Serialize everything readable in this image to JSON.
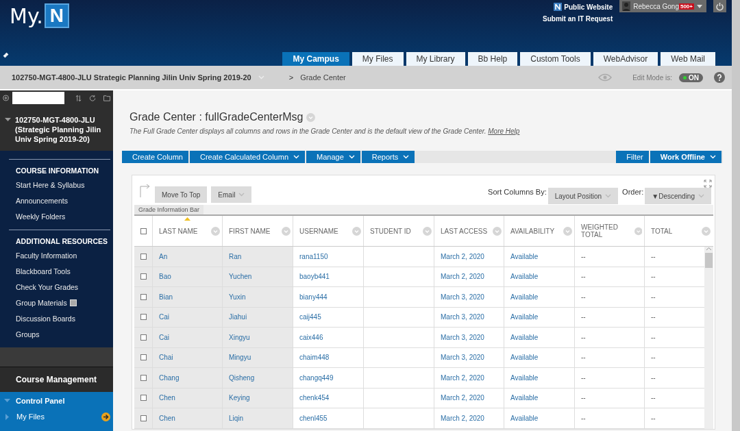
{
  "header": {
    "logo": {
      "text": "My.",
      "mark": "N"
    },
    "links": [
      "Public Website",
      "Submit an IT Request"
    ],
    "user": {
      "name": "Rebecca Gong",
      "badge": "500+"
    },
    "tabs": [
      {
        "label": "My Campus",
        "selected": true
      },
      {
        "label": "My Files",
        "selected": false
      },
      {
        "label": "My Library",
        "selected": false
      },
      {
        "label": "Bb Help",
        "selected": false
      },
      {
        "label": "Custom Tools",
        "selected": false
      },
      {
        "label": "WebAdvisor",
        "selected": false
      },
      {
        "label": "Web Mail",
        "selected": false
      }
    ]
  },
  "breadcrumb": {
    "course": "102750-MGT-4800-JLU Strategic Planning Jilin Univ Spring 2019-20",
    "separator": ">",
    "current": "Grade Center",
    "edit_mode": {
      "label": "Edit Mode is:",
      "value": "ON",
      "on": true
    }
  },
  "sidebar": {
    "course": {
      "title": "102750-MGT-4800-JLU (Strategic Planning Jilin Univ Spring 2019-20)",
      "expanded": true
    },
    "sections": [
      {
        "heading": "COURSE INFORMATION",
        "items": [
          {
            "label": "Start Here & Syllabus",
            "kind": "link"
          },
          {
            "label": "Announcements",
            "kind": "link"
          },
          {
            "label": "Weekly Folders",
            "kind": "link"
          }
        ]
      },
      {
        "heading": "ADDITIONAL RESOURCES",
        "items": [
          {
            "label": "Faculty Information",
            "kind": "link"
          },
          {
            "label": "Blackboard Tools",
            "kind": "link"
          },
          {
            "label": "Check Your Grades",
            "kind": "link"
          },
          {
            "label": "Group Materials",
            "kind": "link-with-icon"
          },
          {
            "label": "Discussion Boards",
            "kind": "link"
          },
          {
            "label": "Groups",
            "kind": "link"
          }
        ]
      }
    ],
    "management": "Course Management",
    "control_panel": {
      "label": "Control Panel",
      "expanded": true,
      "items": [
        {
          "label": "My Files",
          "expanded": false
        }
      ]
    }
  },
  "main": {
    "title": "Grade Center : fullGradeCenterMsg",
    "description": "The Full Grade Center displays all columns and rows in the Grade Center and is the default view of the Grade Center.",
    "help_link": "More Help",
    "toolbar_left": [
      {
        "label": "Create Column",
        "dropdown": false
      },
      {
        "label": "Create Calculated Column",
        "dropdown": true
      },
      {
        "label": "Manage",
        "dropdown": true
      },
      {
        "label": "Reports",
        "dropdown": true
      }
    ],
    "toolbar_right": [
      {
        "label": "Filter",
        "dropdown": false,
        "bold": false
      },
      {
        "label": "Work Offline",
        "dropdown": true,
        "bold": true
      }
    ],
    "grid": {
      "actions": [
        {
          "label": "Move To Top",
          "dropdown": false
        },
        {
          "label": "Email",
          "dropdown": true
        }
      ],
      "sort_label": "Sort Columns By:",
      "sort_value": "Layout Position",
      "order_label": "Order:",
      "order_value": "▼Descending",
      "info_bar": "Grade Information Bar",
      "select_all_checked": false,
      "columns": [
        {
          "label": "LAST NAME",
          "sorted": true
        },
        {
          "label": "FIRST NAME",
          "sorted": false
        },
        {
          "label": "USERNAME",
          "sorted": false
        },
        {
          "label": "STUDENT ID",
          "sorted": false
        },
        {
          "label": "LAST ACCESS",
          "sorted": false
        },
        {
          "label": "AVAILABILITY",
          "sorted": false
        },
        {
          "label": "WEIGHTED TOTAL",
          "sorted": false
        },
        {
          "label": "TOTAL",
          "sorted": false
        }
      ],
      "rows": [
        {
          "checked": false,
          "cells": [
            "An",
            "Ran",
            "rana1150",
            "",
            "March 2, 2020",
            "Available",
            "--",
            "--"
          ]
        },
        {
          "checked": false,
          "cells": [
            "Bao",
            "Yuchen",
            "baoyb441",
            "",
            "March 2, 2020",
            "Available",
            "--",
            "--"
          ]
        },
        {
          "checked": false,
          "cells": [
            "Bian",
            "Yuxin",
            "biany444",
            "",
            "March 3, 2020",
            "Available",
            "--",
            "--"
          ]
        },
        {
          "checked": false,
          "cells": [
            "Cai",
            "Jiahui",
            "caij445",
            "",
            "March 3, 2020",
            "Available",
            "--",
            "--"
          ]
        },
        {
          "checked": false,
          "cells": [
            "Cai",
            "Xingyu",
            "caix446",
            "",
            "March 3, 2020",
            "Available",
            "--",
            "--"
          ]
        },
        {
          "checked": false,
          "cells": [
            "Chai",
            "Mingyu",
            "chaim448",
            "",
            "March 3, 2020",
            "Available",
            "--",
            "--"
          ]
        },
        {
          "checked": false,
          "cells": [
            "Chang",
            "Qisheng",
            "changq449",
            "",
            "March 2, 2020",
            "Available",
            "--",
            "--"
          ]
        },
        {
          "checked": false,
          "cells": [
            "Chen",
            "Keying",
            "chenk454",
            "",
            "March 2, 2020",
            "Available",
            "--",
            "--"
          ]
        },
        {
          "checked": false,
          "cells": [
            "Chen",
            "Liqin",
            "chenl455",
            "",
            "March 2, 2020",
            "Available",
            "--",
            "--"
          ]
        }
      ]
    }
  }
}
